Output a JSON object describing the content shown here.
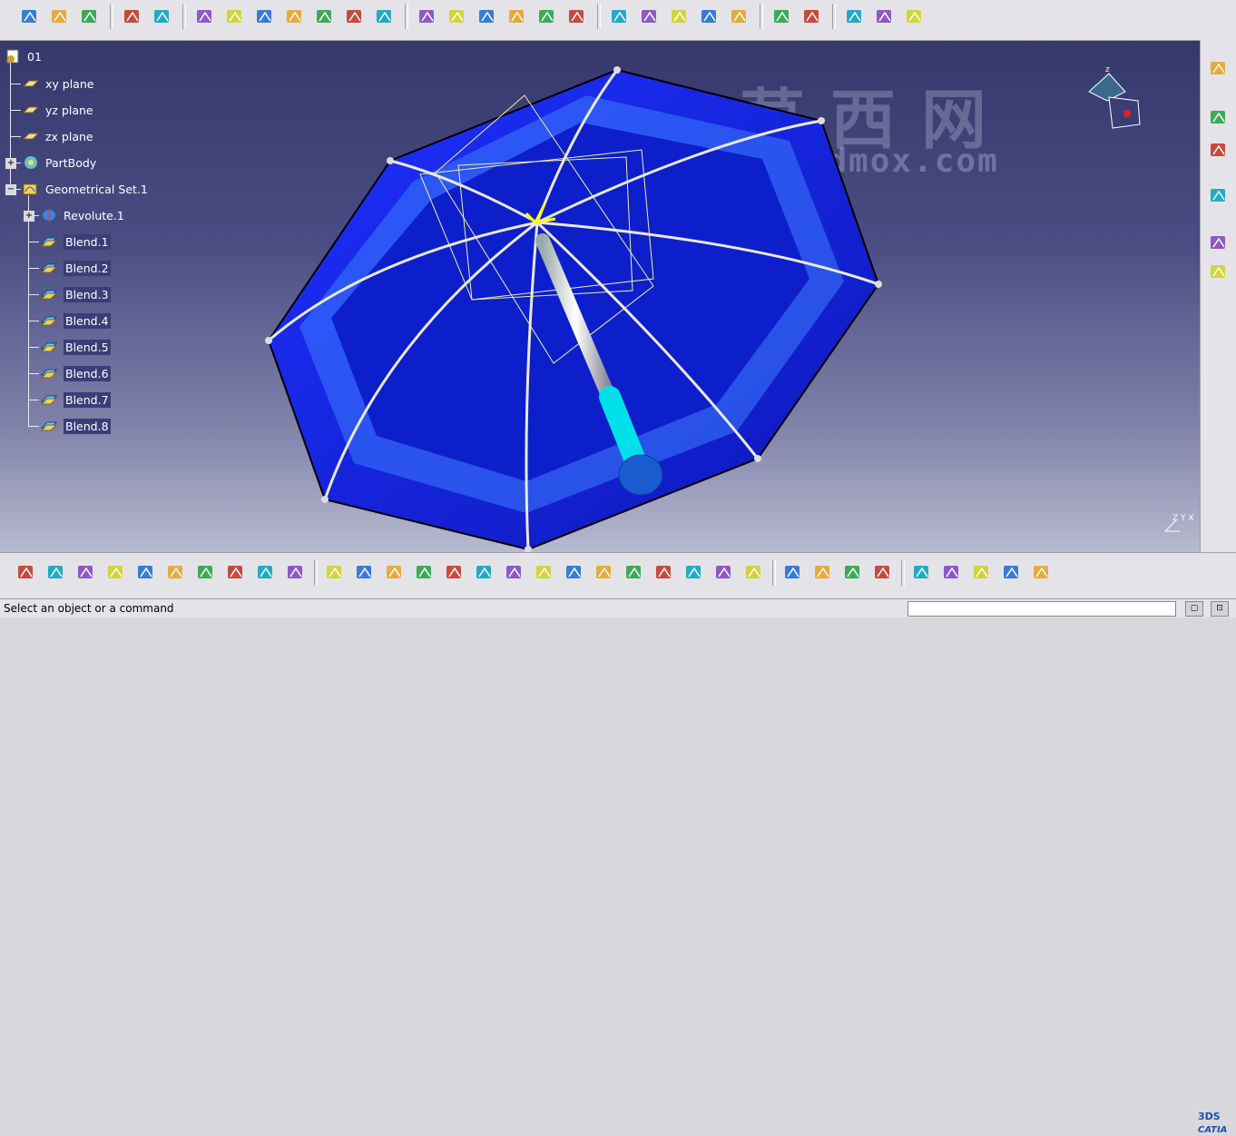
{
  "tree": {
    "root": "01",
    "items": [
      {
        "label": "xy plane",
        "icon": "plane-icon"
      },
      {
        "label": "yz plane",
        "icon": "plane-icon"
      },
      {
        "label": "zx plane",
        "icon": "plane-icon"
      },
      {
        "label": "PartBody",
        "icon": "partbody-icon"
      },
      {
        "label": "Geometrical Set.1",
        "icon": "geometrical-set-icon"
      },
      {
        "label": "Revolute.1",
        "icon": "revolute-icon"
      },
      {
        "label": "Blend.1",
        "icon": "blend-icon"
      },
      {
        "label": "Blend.2",
        "icon": "blend-icon"
      },
      {
        "label": "Blend.3",
        "icon": "blend-icon"
      },
      {
        "label": "Blend.4",
        "icon": "blend-icon"
      },
      {
        "label": "Blend.5",
        "icon": "blend-icon"
      },
      {
        "label": "Blend.6",
        "icon": "blend-icon"
      },
      {
        "label": "Blend.7",
        "icon": "blend-icon"
      },
      {
        "label": "Blend.8",
        "icon": "blend-icon"
      }
    ]
  },
  "watermark": {
    "chinese": "莫西网",
    "url": "www.3dmox.com"
  },
  "status": {
    "message": "Select an object or a command",
    "command_input": ""
  },
  "brand": {
    "logo_text": "CATIA",
    "colors": {
      "viewport_top": "#35386b",
      "viewport_bottom": "#b8bad0",
      "canopy": "#1a1ad0",
      "accent": "#00e0e8"
    }
  },
  "axis_label": "Z Y X",
  "top_toolbar_icons": [
    "point-icon",
    "line-icon",
    "plane-icon",
    "projection-icon",
    "combine-icon",
    "circle-icon",
    "spline-icon",
    "extrude-icon",
    "revolve-icon",
    "sphere-icon",
    "cylinder-icon",
    "offset-icon",
    "sweep-icon",
    "fill-icon",
    "multisection-icon",
    "blend-icon",
    "join-icon",
    "split-icon",
    "trim-icon",
    "boundary-icon",
    "extrapolate-icon",
    "transform-icon",
    "analysis-icon",
    "draft-analysis-icon",
    "curvature-icon",
    "porcupine-icon",
    "axis-system-icon",
    "knowledge-icon"
  ],
  "bottom_toolbar_icons": [
    "new-icon",
    "open-icon",
    "save-icon",
    "print-icon",
    "cut-icon",
    "copy-icon",
    "paste-icon",
    "undo-icon",
    "redo-icon",
    "whats-this-icon",
    "fly-mode-icon",
    "fit-all-icon",
    "pan-icon",
    "rotate-icon",
    "zoom-in-icon",
    "zoom-out-icon",
    "normal-view-icon",
    "multi-view-icon",
    "iso-view-icon",
    "shading-icon",
    "hide-show-icon",
    "swap-space-icon",
    "measure-icon",
    "measure-inertia-icon",
    "apply-material-icon",
    "capture-icon",
    "update-icon",
    "manipulation-icon",
    "axis-icon",
    "grid-icon",
    "snap-icon",
    "sketch-icon",
    "3d-compass-icon",
    "catalog-icon"
  ],
  "right_toolbar_icons": [
    "sketcher-icon",
    "select-icon",
    "more-arrow-icon",
    "annotation-icon",
    "part-design-icon",
    "wireframe-icon"
  ]
}
